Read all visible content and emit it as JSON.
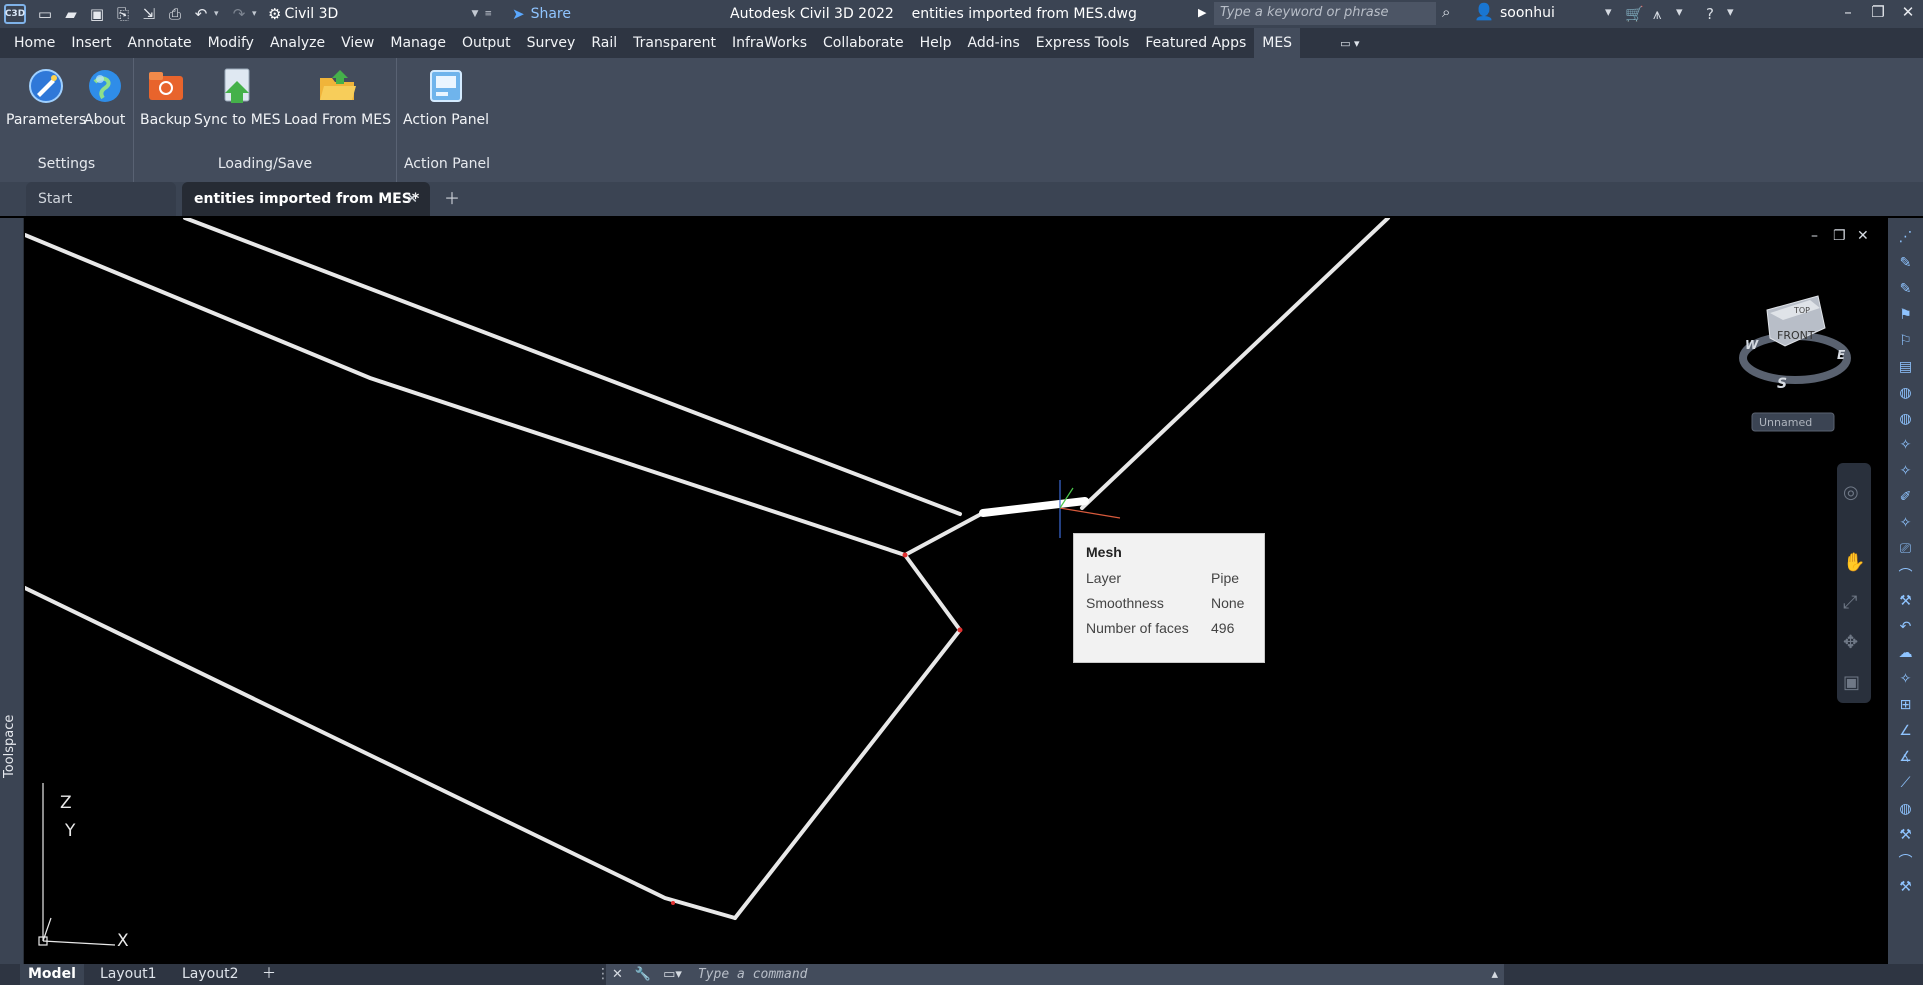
{
  "titlebar": {
    "app_badge": "C3D",
    "workspace": "Civil 3D",
    "share": "Share",
    "title": "Autodesk Civil 3D 2022    entities imported from MES.dwg",
    "search_placeholder": "Type a keyword or phrase",
    "user": "soonhui"
  },
  "menu_tabs": [
    "Home",
    "Insert",
    "Annotate",
    "Modify",
    "Analyze",
    "View",
    "Manage",
    "Output",
    "Survey",
    "Rail",
    "Transparent",
    "InfraWorks",
    "Collaborate",
    "Help",
    "Add-ins",
    "Express Tools",
    "Featured Apps",
    "MES"
  ],
  "active_tab": "MES",
  "ribbon": {
    "settings": {
      "title": "Settings",
      "buttons": [
        "Parameters",
        "About"
      ]
    },
    "loading": {
      "title": "Loading/Save",
      "buttons": [
        "Backup",
        "Sync to MES",
        "Load From MES"
      ]
    },
    "action": {
      "title": "Action Panel",
      "buttons": [
        "Action Panel"
      ]
    }
  },
  "file_tabs": {
    "start": "Start",
    "doc": "entities imported from MES*"
  },
  "toolspace": "Toolspace",
  "viewcube": {
    "top": "TOP",
    "front": "FRONT",
    "n": "",
    "s": "S",
    "e": "E",
    "w": "W",
    "ucs": "Unnamed"
  },
  "tooltip": {
    "title": "Mesh",
    "rows": [
      {
        "key": "Layer",
        "value": "Pipe"
      },
      {
        "key": "Smoothness",
        "value": "None"
      },
      {
        "key": "Number of faces",
        "value": "496"
      }
    ]
  },
  "axis": {
    "z": "Z",
    "y": "Y",
    "x": "X"
  },
  "layouts": [
    "Model",
    "Layout1",
    "Layout2"
  ],
  "command_placeholder": "Type a command",
  "colors": {
    "titlebar": "#3b4453",
    "ribbon": "#434c5c",
    "viewport": "#000000",
    "accent": "#5aa8ff"
  }
}
